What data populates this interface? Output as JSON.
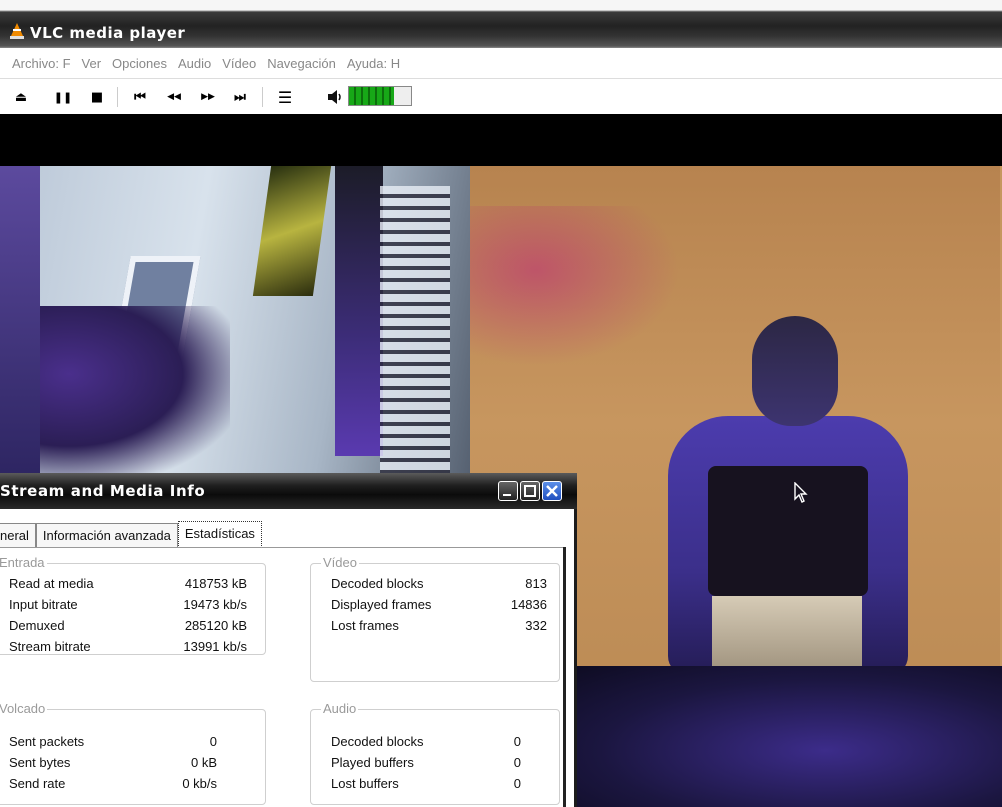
{
  "window": {
    "title": "VLC media player"
  },
  "menu": [
    "Archivo: F",
    "Ver",
    "Opciones",
    "Audio",
    "Vídeo",
    "Navegación",
    "Ayuda: H"
  ],
  "toolbar": {
    "eject": "⏏",
    "pause": "❚❚",
    "stop": "■",
    "prev": "⏮",
    "rewind": "◀◀",
    "forward": "▶▶",
    "next": "⏭",
    "playlist": "☰",
    "volume_level": 0.72
  },
  "dialog": {
    "title": "Stream and Media Info",
    "tabs": [
      "neral",
      "Información avanzada",
      "Estadísticas"
    ],
    "active_tab": "Estadísticas",
    "input": {
      "title": "Entrada",
      "rows": [
        {
          "label": "Read at media",
          "value": "418753 kB"
        },
        {
          "label": "Input bitrate",
          "value": "19473 kb/s"
        },
        {
          "label": "Demuxed",
          "value": "285120 kB"
        },
        {
          "label": "Stream bitrate",
          "value": "13991 kb/s"
        }
      ]
    },
    "video": {
      "title": "Vídeo",
      "rows": [
        {
          "label": "Decoded blocks",
          "value": "813"
        },
        {
          "label": "Displayed frames",
          "value": "14836"
        },
        {
          "label": "Lost frames",
          "value": "332"
        }
      ]
    },
    "dump": {
      "title": "Volcado",
      "rows": [
        {
          "label": "Sent packets",
          "value": "0"
        },
        {
          "label": "Sent bytes",
          "value": "0 kB"
        },
        {
          "label": "Send rate",
          "value": "0 kb/s"
        }
      ]
    },
    "audio": {
      "title": "Audio",
      "rows": [
        {
          "label": "Decoded blocks",
          "value": "0"
        },
        {
          "label": "Played buffers",
          "value": "0"
        },
        {
          "label": "Lost buffers",
          "value": "0"
        }
      ]
    }
  },
  "colors": {
    "volume": "#17a817",
    "close_button": "#2a5fd0",
    "title_bar": "#1f1f1f"
  }
}
